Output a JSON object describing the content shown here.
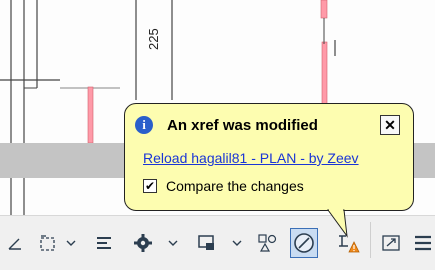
{
  "drawing": {
    "dimension_text": "225"
  },
  "notification": {
    "title": "An xref was modified",
    "close_label": "✕",
    "reload_link": "Reload hagalil81 - PLAN - by Zeev",
    "compare_label": "Compare the changes",
    "compare_checked": true,
    "check_glyph": "✔",
    "info_glyph": "i",
    "background_color": "#fdfdb0",
    "link_color": "#1a35d6"
  },
  "toolbar": {
    "icons": [
      "dimension-corner-icon",
      "rectangle-select-icon",
      "chevron-down-icon",
      "properties-list-icon",
      "gear-icon",
      "chevron-down-icon",
      "viewport-icon",
      "chevron-down-icon",
      "shapes-icon",
      "snap-circle-icon",
      "xref-warning-icon",
      "maximize-icon",
      "menu-icon"
    ]
  }
}
